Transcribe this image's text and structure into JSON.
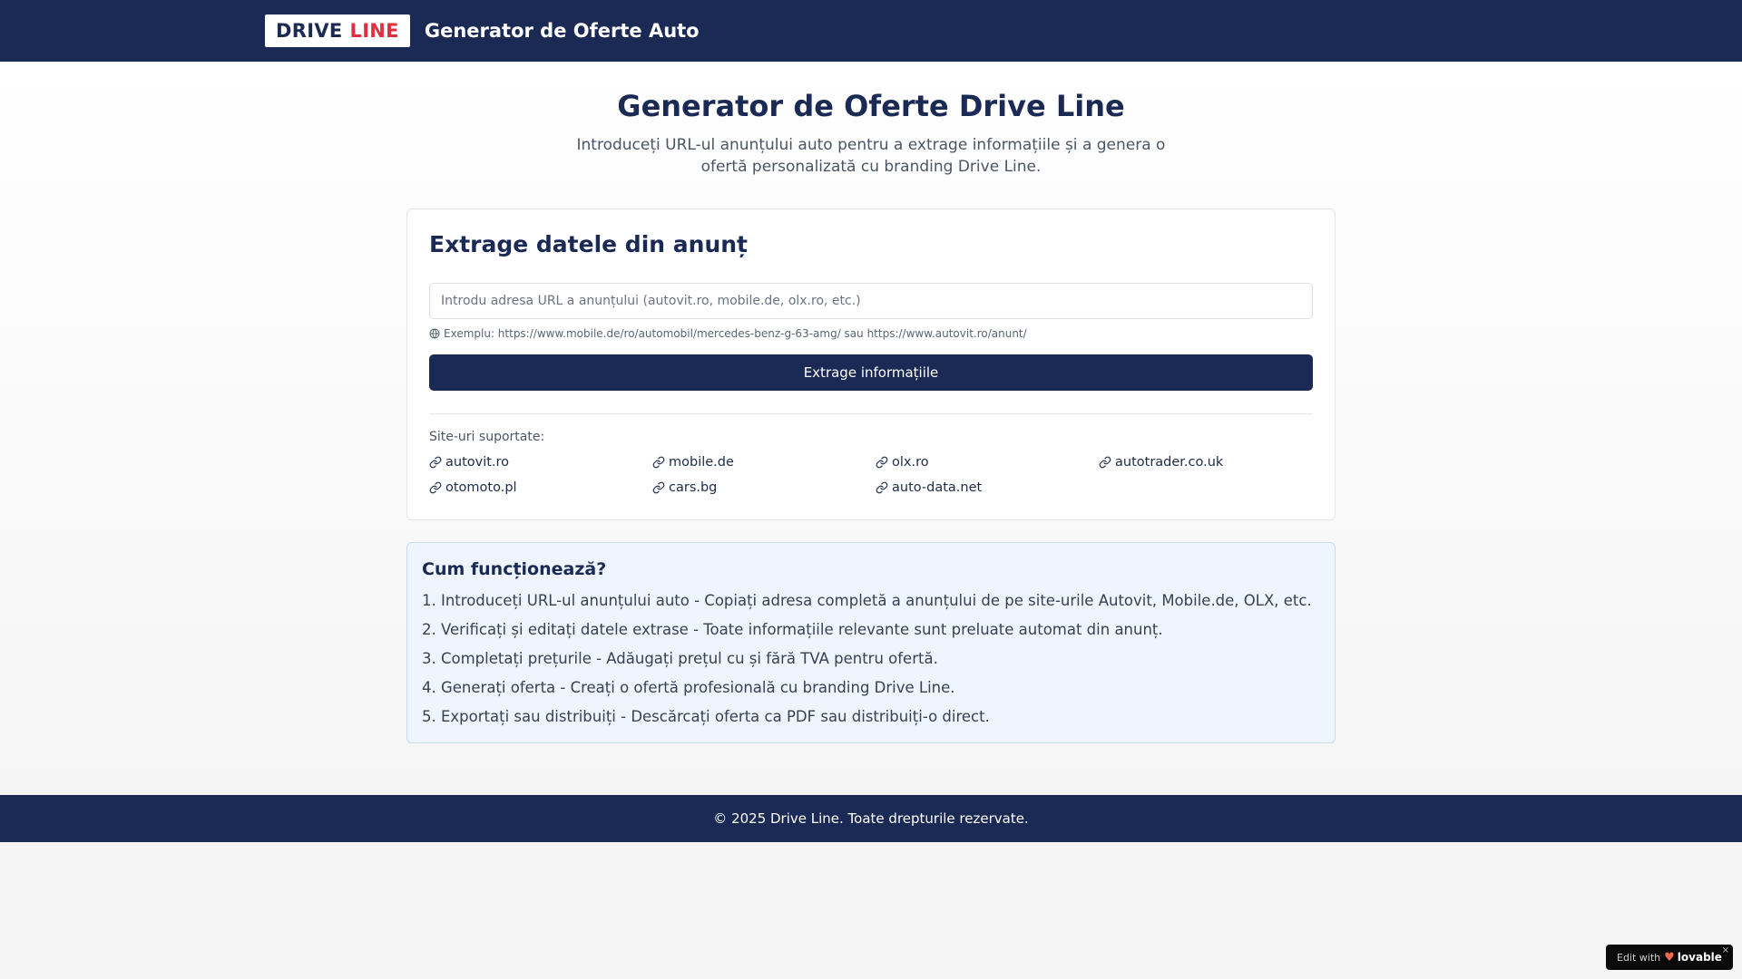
{
  "header": {
    "logo_part1": "DRIVE",
    "logo_part2": "LINE",
    "title": "Generator de Oferte Auto"
  },
  "hero": {
    "title": "Generator de Oferte Drive Line",
    "subtitle": "Introduceți URL-ul anunțului auto pentru a extrage informațiile și a genera o ofertă personalizată cu branding Drive Line."
  },
  "extract_card": {
    "title": "Extrage datele din anunț",
    "input_placeholder": "Introdu adresa URL a anunțului (autovit.ro, mobile.de, olx.ro, etc.)",
    "input_value": "",
    "example_text": "Exemplu: https://www.mobile.de/ro/automobil/mercedes-benz-g-63-amg/ sau https://www.autovit.ro/anunt/",
    "button_label": "Extrage informațiile",
    "sites_label": "Site-uri suportate:",
    "sites": [
      "autovit.ro",
      "mobile.de",
      "olx.ro",
      "autotrader.co.uk",
      "otomoto.pl",
      "cars.bg",
      "auto-data.net"
    ]
  },
  "how_it_works": {
    "title": "Cum funcționează?",
    "steps": [
      "1. Introduceți URL-ul anunțului auto - Copiați adresa completă a anunțului de pe site-urile Autovit, Mobile.de, OLX, etc.",
      "2. Verificați și editați datele extrase - Toate informațiile relevante sunt preluate automat din anunț.",
      "3. Completați prețurile - Adăugați prețul cu și fără TVA pentru ofertă.",
      "4. Generați oferta - Creați o ofertă profesională cu branding Drive Line.",
      "5. Exportați sau distribuiți - Descărcați oferta ca PDF sau distribuiți-o direct."
    ]
  },
  "footer": {
    "copyright": "© 2025 Drive Line. Toate drepturile rezervate."
  },
  "badge": {
    "prefix": "Edit with",
    "brand": "lovable",
    "close": "×"
  },
  "colors": {
    "navy": "#1b2a55",
    "accent_red": "#e0303f",
    "info_bg": "#eef5fe"
  },
  "icons": {
    "example": "globe-icon",
    "site": "link-icon"
  }
}
